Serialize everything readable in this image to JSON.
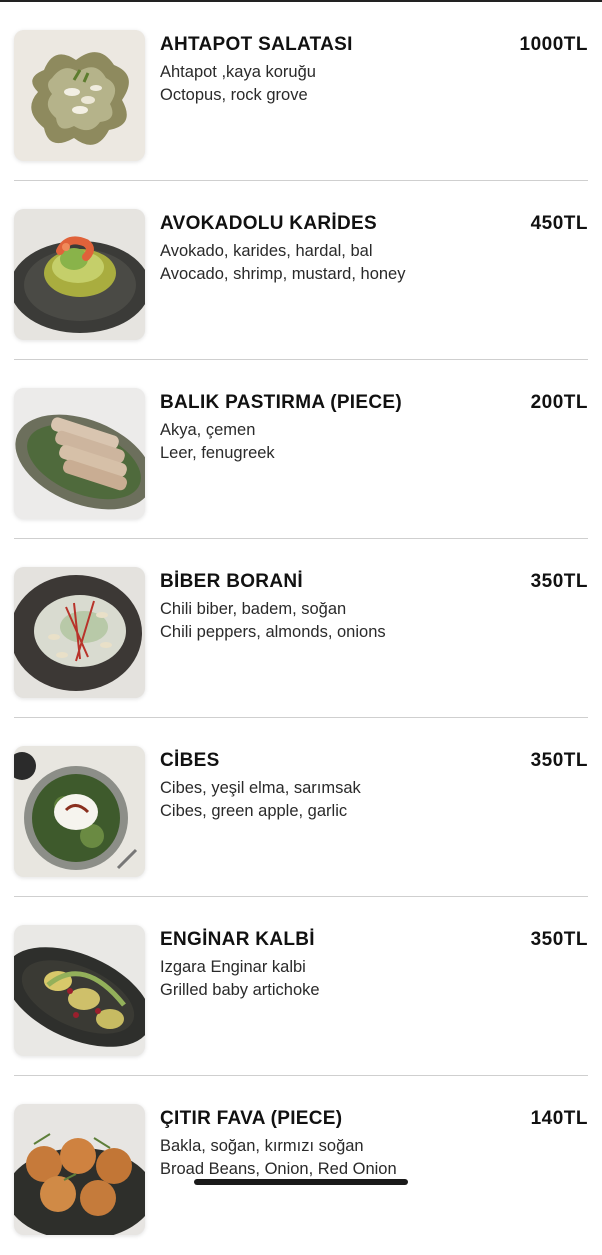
{
  "menu": {
    "items": [
      {
        "name": "AHTAPOT SALATASI",
        "price": "1000TL",
        "desc_tr": "Ahtapot ,kaya koruğu",
        "desc_en": "Octopus, rock grove",
        "image": "octopus-salad-photo"
      },
      {
        "name": "AVOKADOLU KARİDES",
        "price": "450TL",
        "desc_tr": "Avokado, karides, hardal, bal",
        "desc_en": "Avocado, shrimp, mustard, honey",
        "image": "avocado-shrimp-photo"
      },
      {
        "name": "BALIK PASTIRMA (PIECE)",
        "price": "200TL",
        "desc_tr": "Akya, çemen",
        "desc_en": "Leer, fenugreek",
        "image": "fish-pastrami-photo"
      },
      {
        "name": "BİBER BORANİ",
        "price": "350TL",
        "desc_tr": "Chili biber, badem, soğan",
        "desc_en": "Chili peppers, almonds, onions",
        "image": "pepper-borani-photo"
      },
      {
        "name": "CİBES",
        "price": "350TL",
        "desc_tr": "Cibes, yeşil elma, sarımsak",
        "desc_en": "Cibes, green apple, garlic",
        "image": "cibes-photo"
      },
      {
        "name": "ENGİNAR KALBİ",
        "price": "350TL",
        "desc_tr": "Izgara Enginar kalbi",
        "desc_en": "Grilled baby artichoke",
        "image": "artichoke-heart-photo"
      },
      {
        "name": "ÇITIR FAVA (PIECE)",
        "price": "140TL",
        "desc_tr": "Bakla, soğan, kırmızı soğan",
        "desc_en": "Broad Beans, Onion, Red Onion",
        "image": "crispy-fava-photo"
      }
    ]
  }
}
